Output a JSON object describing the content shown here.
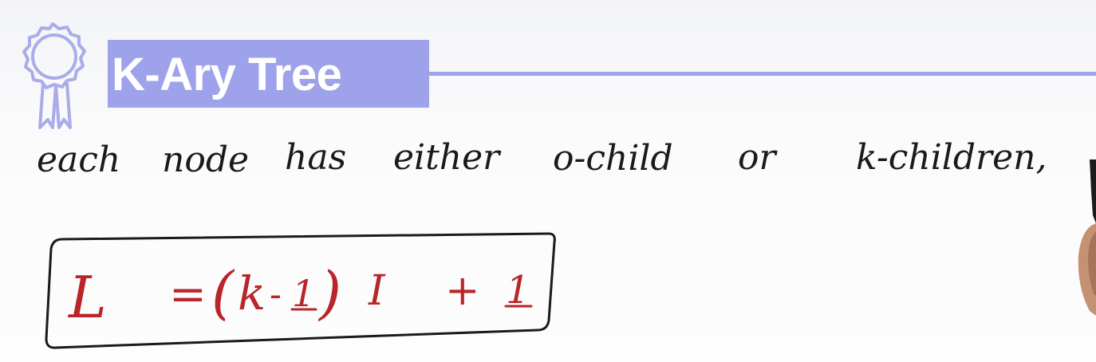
{
  "slide": {
    "title": "K-Ary Tree",
    "definition": {
      "words": [
        "each",
        "node",
        "has",
        "either",
        "o-child",
        "or",
        "k-children,"
      ]
    },
    "formula": {
      "lhs": "L",
      "equals": "=",
      "open_paren": "(",
      "k": "k",
      "minus": "-",
      "one_a": "1",
      "close_paren": ")",
      "I": "I",
      "plus": "+",
      "one_b": "1"
    },
    "icon": "award-badge-icon",
    "colors": {
      "title_highlight": "#9ea2ea",
      "ink_black": "#1a1a1a",
      "ink_red": "#b8262a"
    }
  }
}
